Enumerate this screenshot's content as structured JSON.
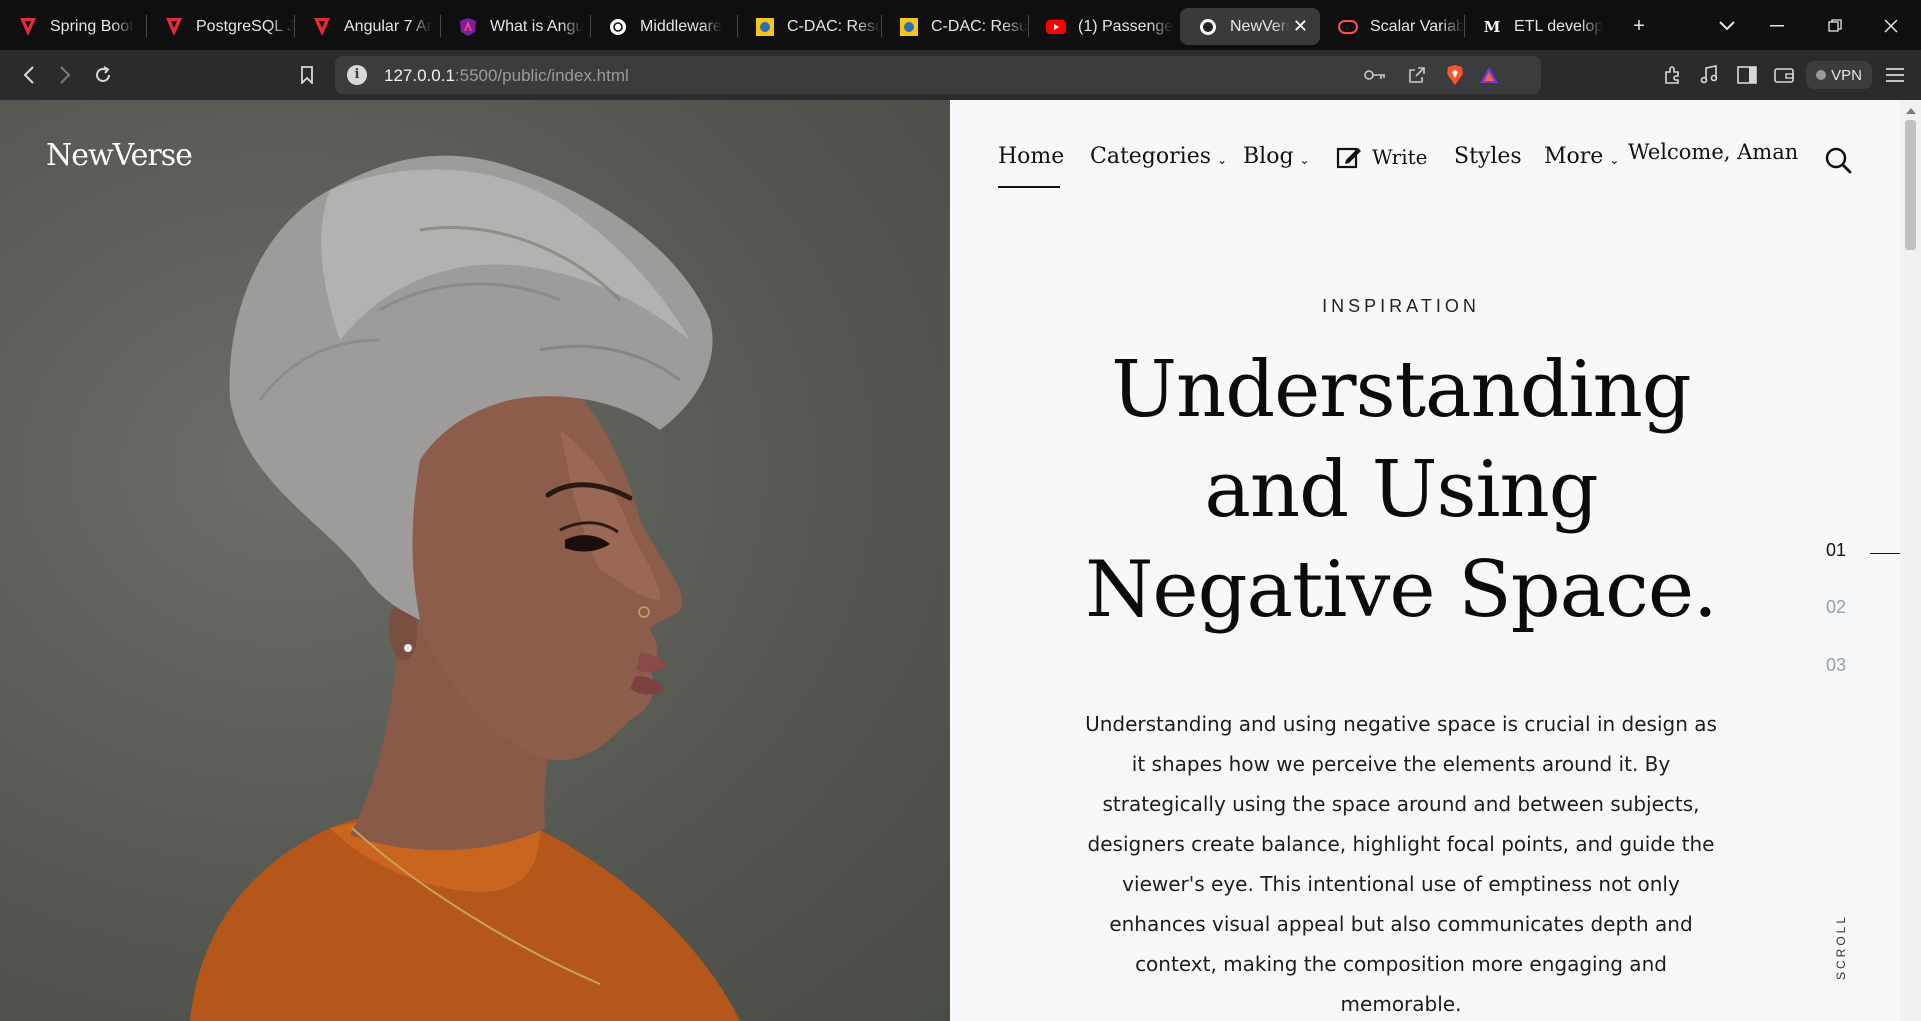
{
  "browser": {
    "tabs": [
      {
        "title": "Spring Boot",
        "icon": "red-v-icon",
        "color": "#e12d39"
      },
      {
        "title": "PostgreSQL J",
        "icon": "red-v-icon",
        "color": "#e12d39"
      },
      {
        "title": "Angular 7 Ar",
        "icon": "red-v-icon",
        "color": "#e12d39"
      },
      {
        "title": "What is Angu",
        "icon": "angular-icon",
        "color": "#c3002f"
      },
      {
        "title": "Middleware",
        "icon": "openai-icon",
        "color": "#ffffff"
      },
      {
        "title": "C-DAC: Resu",
        "icon": "cdac-icon",
        "color": "#f5c518"
      },
      {
        "title": "C-DAC: Resu",
        "icon": "cdac-icon",
        "color": "#f5c518"
      },
      {
        "title": "(1) Passenge",
        "icon": "youtube-icon",
        "color": "#ff0000"
      },
      {
        "title": "NewVers",
        "icon": "newverse-icon",
        "color": "#ffffff",
        "active": true
      },
      {
        "title": "Scalar Variab",
        "icon": "scalar-icon",
        "color": "#ff4d4d"
      },
      {
        "title": "ETL develop",
        "icon": "medium-icon",
        "color": "#ffffff"
      }
    ],
    "new_tab_label": "+",
    "url_host": "127.0.0.1",
    "url_rest": ":5500/public/index.html",
    "vpn_label": "VPN"
  },
  "site": {
    "brand": "NewVerse",
    "nav": {
      "home": "Home",
      "categories": "Categories",
      "blog": "Blog",
      "write": "Write",
      "styles": "Styles",
      "more": "More",
      "welcome": "Welcome, Aman"
    },
    "hero": {
      "kicker": "INSPIRATION",
      "title_lines": [
        "Understanding",
        "and Using",
        "Negative Space."
      ],
      "body": "Understanding and using negative space is crucial in design as it shapes how we perceive the elements around it. By strategically using the space around and between subjects, designers create balance, highlight focal points, and guide the viewer's eye. This intentional use of emptiness not only enhances visual appeal but also communicates depth and context, making the composition more engaging and memorable."
    },
    "pager": [
      "01",
      "02",
      "03"
    ],
    "pager_active": 0,
    "scroll_label": "SCROLL"
  },
  "colors": {
    "hero_bg": "#5a5d55",
    "content_bg": "#f7f8fa",
    "active_tab": "#3a3a3d"
  }
}
